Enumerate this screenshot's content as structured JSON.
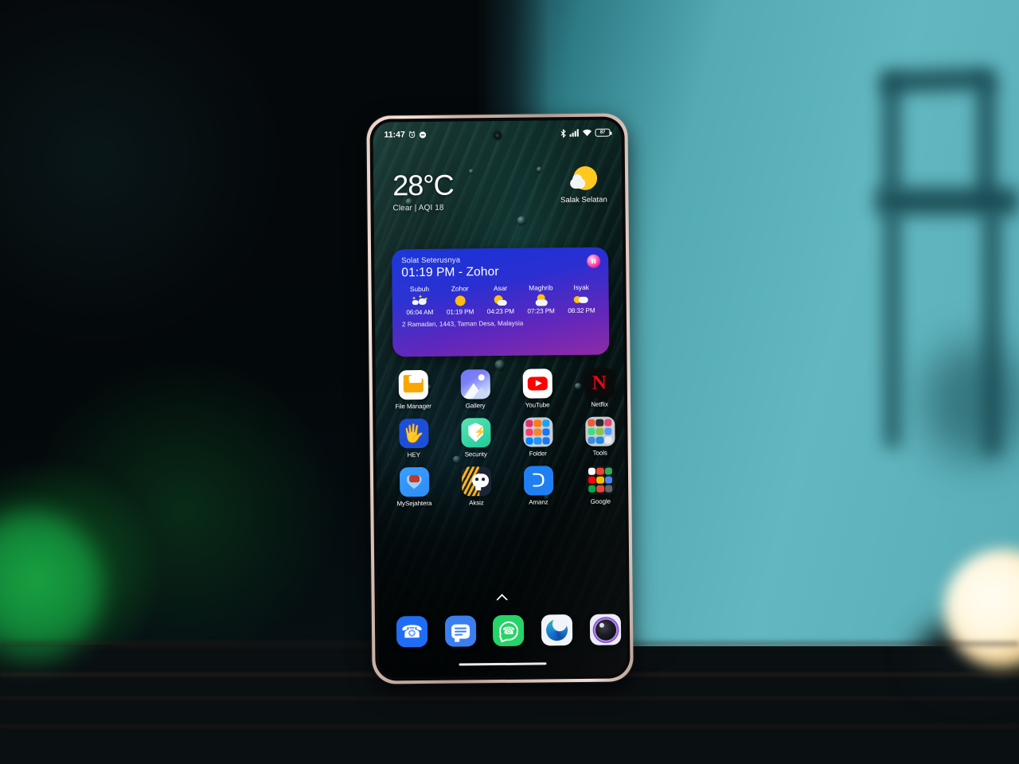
{
  "scene": {
    "description": "smartphone on wooden table",
    "wall_color": "#5fb3bd",
    "table_color": "#c2a183",
    "backdrop_color": "#05080a"
  },
  "phone": {
    "frame_color": "#e8cfc4",
    "statusbar": {
      "time": "11:47",
      "left_icons": [
        "alarm-icon",
        "dnd-icon"
      ],
      "right_icons": [
        "bluetooth-icon",
        "signal-icon",
        "wifi-icon",
        "battery-icon"
      ],
      "battery_level": "87"
    },
    "weather_widget": {
      "temperature": "28°C",
      "condition": "Clear | AQI 18",
      "location": "Salak Selatan",
      "icon": "sun-behind-cloud-icon"
    },
    "prayer_widget": {
      "title": "Solat Seterusnya",
      "next": "01:19 PM - Zohor",
      "badge": "n",
      "gradient_from": "#1633d8",
      "gradient_to": "#8e2ba6",
      "times": [
        {
          "name": "Subuh",
          "time": "06:04 AM",
          "icon": "stars-night-icon"
        },
        {
          "name": "Zohor",
          "time": "01:19 PM",
          "icon": "sun-icon"
        },
        {
          "name": "Asar",
          "time": "04:23 PM",
          "icon": "sun-cloud-icon"
        },
        {
          "name": "Maghrib",
          "time": "07:23 PM",
          "icon": "sunset-cloud-icon"
        },
        {
          "name": "Isyak",
          "time": "08:32 PM",
          "icon": "moon-cloud-icon"
        }
      ],
      "footer": "2 Ramadan, 1443, Taman Desa, Malaysia"
    },
    "app_rows": [
      [
        {
          "label": "File Manager",
          "icon": "file-manager-icon"
        },
        {
          "label": "Gallery",
          "icon": "gallery-icon"
        },
        {
          "label": "YouTube",
          "icon": "youtube-icon"
        },
        {
          "label": "Netflix",
          "icon": "netflix-icon",
          "glyph": "N"
        }
      ],
      [
        {
          "label": "HEY",
          "icon": "hey-icon",
          "glyph": "🖐"
        },
        {
          "label": "Security",
          "icon": "security-shield-icon",
          "glyph": "⚡"
        },
        {
          "label": "Folder",
          "icon": "folder-social-icon"
        },
        {
          "label": "Tools",
          "icon": "folder-tools-icon"
        }
      ],
      [
        {
          "label": "MySejahtera",
          "icon": "mysejahtera-icon"
        },
        {
          "label": "Aksiz",
          "icon": "aksiz-icon"
        },
        {
          "label": "Amanz",
          "icon": "amanz-icon",
          "glyph": "ᑕ"
        },
        {
          "label": "Google",
          "icon": "folder-google-icon"
        }
      ]
    ],
    "folder_social_colors": [
      "#e1306c",
      "#ff7a1a",
      "#1da1f2",
      "#ff3b6b",
      "#f58529",
      "#1877f2",
      "#0084ff",
      "#2196f3",
      "#1877f2"
    ],
    "folder_tools_colors": [
      "#ef5a35",
      "#2b2b2b",
      "#e8486f",
      "#3ddc84",
      "#8bc34a",
      "#4f9bff",
      "#3f8ae0",
      "#1e88e5",
      "#e8eaf0"
    ],
    "folder_google_colors": [
      "#ffffff",
      "#ea4335",
      "#34a853",
      "#ff0000",
      "#fbbc05",
      "#4285f4",
      "#00ac47",
      "#ea4335",
      "#5f6368"
    ],
    "dock": [
      {
        "label": "Phone",
        "icon": "phone-icon"
      },
      {
        "label": "Messages",
        "icon": "messages-icon"
      },
      {
        "label": "WhatsApp",
        "icon": "whatsapp-icon"
      },
      {
        "label": "Edge",
        "icon": "edge-browser-icon"
      },
      {
        "label": "Camera",
        "icon": "camera-icon"
      }
    ],
    "app_drawer_indicator": "chevron-up-icon",
    "home_gesture_bar": true
  }
}
